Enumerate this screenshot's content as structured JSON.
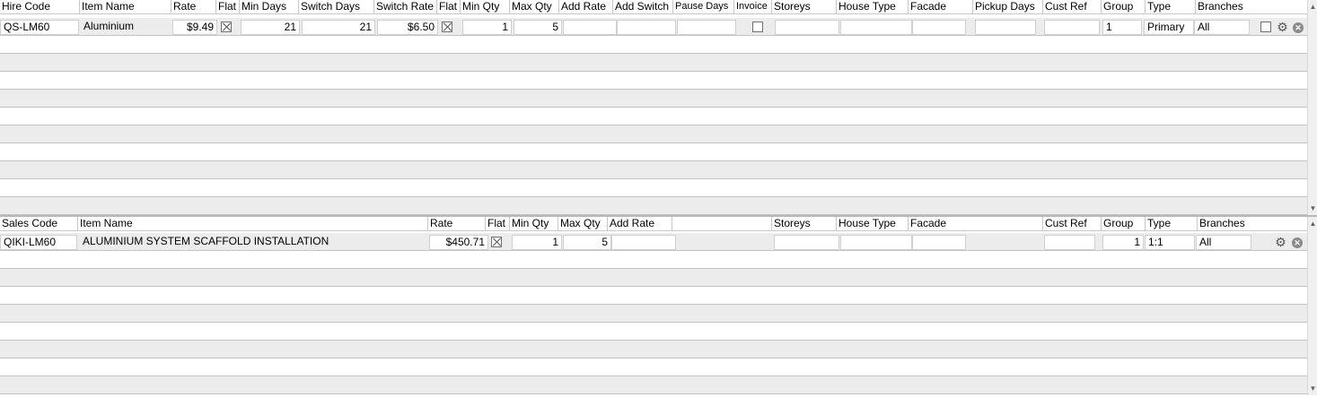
{
  "hire": {
    "headers": {
      "code": "Hire Code",
      "item_name": "Item Name",
      "rate": "Rate",
      "flat": "Flat",
      "min_days": "Min Days",
      "switch_days": "Switch Days",
      "switch_rate": "Switch Rate",
      "flat2": "Flat",
      "min_qty": "Min Qty",
      "max_qty": "Max Qty",
      "add_rate": "Add Rate",
      "add_switch": "Add Switch",
      "pause_days": "Pause Days",
      "invoice": "Invoice",
      "storeys": "Storeys",
      "house_type": "House Type",
      "facade": "Facade",
      "pickup_days": "Pickup Days",
      "cust_ref": "Cust Ref",
      "group": "Group",
      "type": "Type",
      "branches": "Branches"
    },
    "row": {
      "code": "QS-LM60",
      "item_name": "Aluminium",
      "rate": "$9.49",
      "flat": true,
      "min_days": "21",
      "switch_days": "21",
      "switch_rate": "$6.50",
      "flat2": true,
      "min_qty": "1",
      "max_qty": "5",
      "add_rate": "",
      "add_switch": "",
      "pause_days": "",
      "invoice": false,
      "storeys": "",
      "house_type": "",
      "facade": "",
      "pickup_days": "",
      "cust_ref": "",
      "group": "1",
      "type": "Primary",
      "branches": "All",
      "selected": false
    }
  },
  "sales": {
    "headers": {
      "code": "Sales Code",
      "item_name": "Item Name",
      "rate": "Rate",
      "flat": "Flat",
      "min_qty": "Min Qty",
      "max_qty": "Max Qty",
      "add_rate": "Add Rate",
      "storeys": "Storeys",
      "house_type": "House Type",
      "facade": "Facade",
      "cust_ref": "Cust Ref",
      "group": "Group",
      "type": "Type",
      "branches": "Branches"
    },
    "row": {
      "code": "QIKI-LM60",
      "item_name": "ALUMINIUM SYSTEM SCAFFOLD INSTALLATION",
      "rate": "$450.71",
      "flat": true,
      "min_qty": "1",
      "max_qty": "5",
      "add_rate": "",
      "storeys": "",
      "house_type": "",
      "facade": "",
      "cust_ref": "",
      "group": "1",
      "type": "1:1",
      "branches": "All"
    }
  },
  "icons": {
    "settings": "gear-icon",
    "remove": "close-circle-icon",
    "scroll_up": "arrow-up-icon",
    "scroll_down": "arrow-down-icon"
  },
  "colors": {
    "alt_row": "#ececec",
    "grid_line": "#c4c4c4"
  }
}
